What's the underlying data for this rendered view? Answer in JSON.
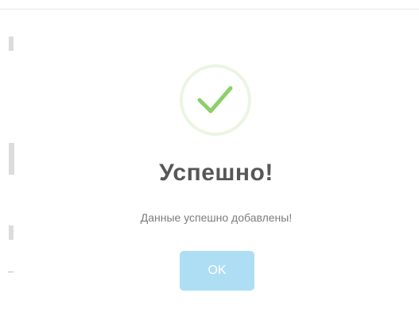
{
  "dialog": {
    "title": "Успешно!",
    "message": "Данные успешно добавлены!",
    "confirm_label": "OK"
  },
  "icons": {
    "status": "checkmark-icon"
  },
  "colors": {
    "success_green": "#8ccf6b",
    "success_ring": "#eaf6e2",
    "button_bg": "#aedef3",
    "title_text": "#575757",
    "message_text": "#7c7c7c"
  }
}
